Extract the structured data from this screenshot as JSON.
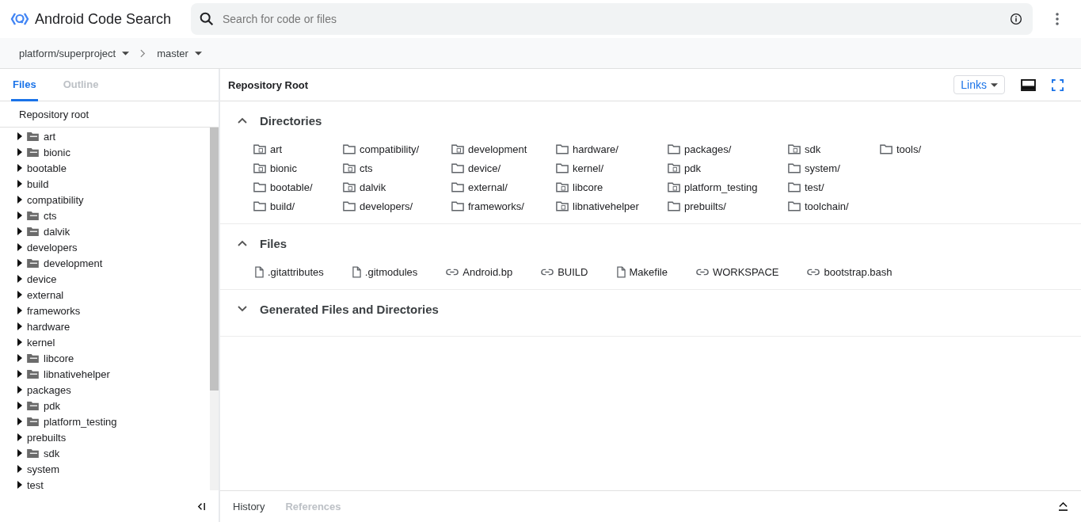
{
  "header": {
    "title": "Android Code Search",
    "search": {
      "placeholder": "Search for code or files"
    }
  },
  "breadcrumb": {
    "repository": "platform/superproject",
    "branch": "master"
  },
  "sidebar": {
    "tabs": [
      {
        "label": "Files",
        "selected": true
      },
      {
        "label": "Outline",
        "selected": false
      }
    ],
    "root": "Repository root",
    "tree": [
      {
        "name": "art",
        "kind": "submodule"
      },
      {
        "name": "bionic",
        "kind": "submodule"
      },
      {
        "name": "bootable",
        "kind": "folder"
      },
      {
        "name": "build",
        "kind": "folder"
      },
      {
        "name": "compatibility",
        "kind": "folder"
      },
      {
        "name": "cts",
        "kind": "submodule"
      },
      {
        "name": "dalvik",
        "kind": "submodule"
      },
      {
        "name": "developers",
        "kind": "folder"
      },
      {
        "name": "development",
        "kind": "submodule"
      },
      {
        "name": "device",
        "kind": "folder"
      },
      {
        "name": "external",
        "kind": "folder"
      },
      {
        "name": "frameworks",
        "kind": "folder"
      },
      {
        "name": "hardware",
        "kind": "folder"
      },
      {
        "name": "kernel",
        "kind": "folder"
      },
      {
        "name": "libcore",
        "kind": "submodule"
      },
      {
        "name": "libnativehelper",
        "kind": "submodule"
      },
      {
        "name": "packages",
        "kind": "folder"
      },
      {
        "name": "pdk",
        "kind": "submodule"
      },
      {
        "name": "platform_testing",
        "kind": "submodule"
      },
      {
        "name": "prebuilts",
        "kind": "folder"
      },
      {
        "name": "sdk",
        "kind": "submodule"
      },
      {
        "name": "system",
        "kind": "folder"
      },
      {
        "name": "test",
        "kind": "folder"
      }
    ]
  },
  "content": {
    "title": "Repository Root",
    "links_button": "Links",
    "sections": [
      {
        "title": "Directories",
        "expanded": true,
        "kind": "directories",
        "items": [
          {
            "name": "art",
            "kind": "submodule"
          },
          {
            "name": "bionic",
            "kind": "submodule"
          },
          {
            "name": "bootable/",
            "kind": "folder"
          },
          {
            "name": "build/",
            "kind": "folder"
          },
          {
            "name": "compatibility/",
            "kind": "folder"
          },
          {
            "name": "cts",
            "kind": "submodule"
          },
          {
            "name": "dalvik",
            "kind": "submodule"
          },
          {
            "name": "developers/",
            "kind": "folder"
          },
          {
            "name": "development",
            "kind": "submodule"
          },
          {
            "name": "device/",
            "kind": "folder"
          },
          {
            "name": "external/",
            "kind": "folder"
          },
          {
            "name": "frameworks/",
            "kind": "folder"
          },
          {
            "name": "hardware/",
            "kind": "folder"
          },
          {
            "name": "kernel/",
            "kind": "folder"
          },
          {
            "name": "libcore",
            "kind": "submodule"
          },
          {
            "name": "libnativehelper",
            "kind": "submodule"
          },
          {
            "name": "packages/",
            "kind": "folder"
          },
          {
            "name": "pdk",
            "kind": "submodule"
          },
          {
            "name": "platform_testing",
            "kind": "submodule"
          },
          {
            "name": "prebuilts/",
            "kind": "folder"
          },
          {
            "name": "sdk",
            "kind": "submodule"
          },
          {
            "name": "system/",
            "kind": "folder"
          },
          {
            "name": "test/",
            "kind": "folder"
          },
          {
            "name": "toolchain/",
            "kind": "folder"
          },
          {
            "name": "tools/",
            "kind": "folder"
          }
        ]
      },
      {
        "title": "Files",
        "expanded": true,
        "kind": "files",
        "items": [
          {
            "name": ".gitattributes",
            "kind": "file"
          },
          {
            "name": ".gitmodules",
            "kind": "file"
          },
          {
            "name": "Android.bp",
            "kind": "link"
          },
          {
            "name": "BUILD",
            "kind": "link"
          },
          {
            "name": "Makefile",
            "kind": "file"
          },
          {
            "name": "WORKSPACE",
            "kind": "link"
          },
          {
            "name": "bootstrap.bash",
            "kind": "link"
          }
        ]
      },
      {
        "title": "Generated Files and Directories",
        "expanded": false
      }
    ]
  },
  "bottom_panel": {
    "tabs": [
      {
        "label": "History",
        "disabled": false
      },
      {
        "label": "References",
        "disabled": true
      }
    ]
  }
}
